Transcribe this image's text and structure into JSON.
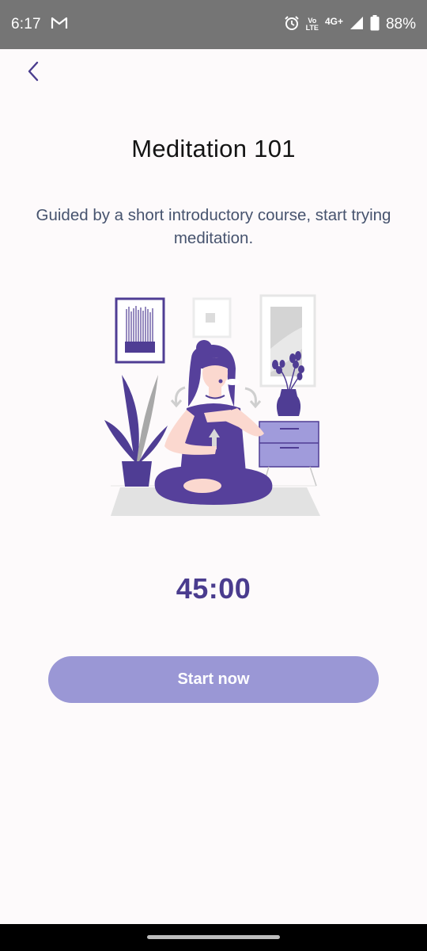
{
  "status_bar": {
    "time": "6:17",
    "volte_line1": "Vo",
    "volte_line2": "LTE",
    "network": "4G+",
    "battery": "88%",
    "icons": [
      "gmail-icon",
      "alarm-icon",
      "volte-icon",
      "signal-icon",
      "battery-icon"
    ]
  },
  "header": {
    "back_icon": "chevron-left-icon"
  },
  "main": {
    "title": "Meditation 101",
    "subtitle": "Guided by a short introductory course, start trying meditation.",
    "illustration": "meditation-illustration",
    "timer": "45:00",
    "start_label": "Start now"
  },
  "colors": {
    "accent": "#4a3c8e",
    "button": "#9a97d5",
    "illustration_purple": "#56409b",
    "status_bar": "#757575"
  }
}
